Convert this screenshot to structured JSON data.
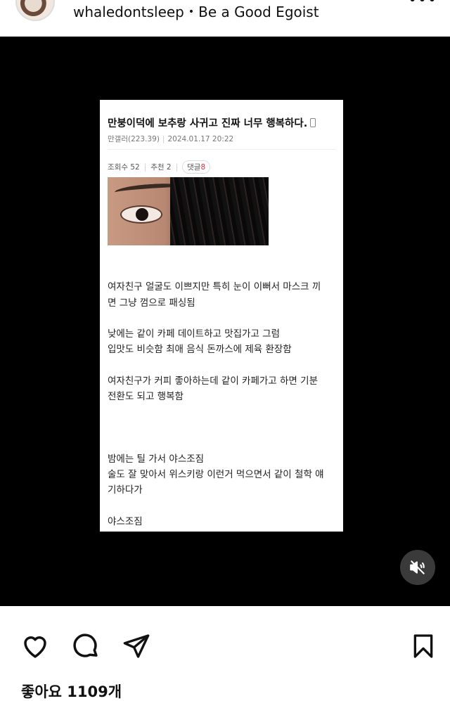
{
  "header": {
    "username": "whaledontsleep",
    "separator": "•",
    "audio_title": "Be a Good Egoist",
    "more": "•••"
  },
  "post": {
    "title": "만붕이덕에 보추랑 사귀고 진짜 너무 행복하다.",
    "author": "만갤러(223.39)",
    "date": "2024.01.17 20:22",
    "views": "조회수 52",
    "recommend": "추천 2",
    "comments_label": "댓글",
    "comments_count": "8",
    "lines": [
      "여자친구 얼굴도 이쁘지만 특히 눈이 이뻐서 마스크 끼",
      "면 그냥 껌으로 패싱됨",
      "낮에는 같이 카페 데이트하고 맛집가고 그럼",
      "입맛도 비슷함 최애 음식 돈까스에 제육 환장함",
      "여자친구가 커피 좋아하는데 같이 카페가고 하면 기분",
      "전환도 되고 행복함",
      "밤에는 틸 가서 야스조짐",
      "술도 잘 맞아서 위스키랑 이런거 먹으면서 같이 철학 얘",
      "기하다가",
      "야스조짐"
    ]
  },
  "likes_text": "좋아요 1109개",
  "icons": {
    "like": "heart-icon",
    "comment": "comment-icon",
    "share": "send-icon",
    "save": "bookmark-icon",
    "mute": "speaker-muted-icon",
    "more": "more-icon"
  }
}
